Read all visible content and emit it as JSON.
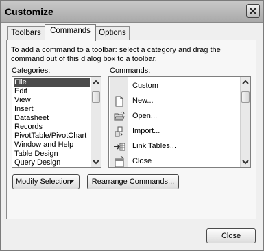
{
  "window": {
    "title": "Customize"
  },
  "tabs": [
    {
      "label": "Toolbars"
    },
    {
      "label": "Commands"
    },
    {
      "label": "Options"
    }
  ],
  "instructions": "To add a command to a toolbar: select a category and drag the command out of this dialog box to a toolbar.",
  "categories": {
    "label": "Categories:",
    "selected": "File",
    "items": [
      "File",
      "Edit",
      "View",
      "Insert",
      "Datasheet",
      "Records",
      "PivotTable/PivotChart",
      "Window and Help",
      "Table Design",
      "Query Design"
    ]
  },
  "commands": {
    "label": "Commands:",
    "items": [
      {
        "label": "Custom",
        "icon": "none"
      },
      {
        "label": "New...",
        "icon": "new-document-icon"
      },
      {
        "label": "Open...",
        "icon": "open-folder-icon"
      },
      {
        "label": "Import...",
        "icon": "import-icon"
      },
      {
        "label": "Link Tables...",
        "icon": "link-tables-icon"
      },
      {
        "label": "Close",
        "icon": "close-window-icon"
      }
    ]
  },
  "buttons": {
    "modify_selection": "Modify Selection",
    "rearrange_commands": "Rearrange Commands...",
    "close": "Close"
  }
}
